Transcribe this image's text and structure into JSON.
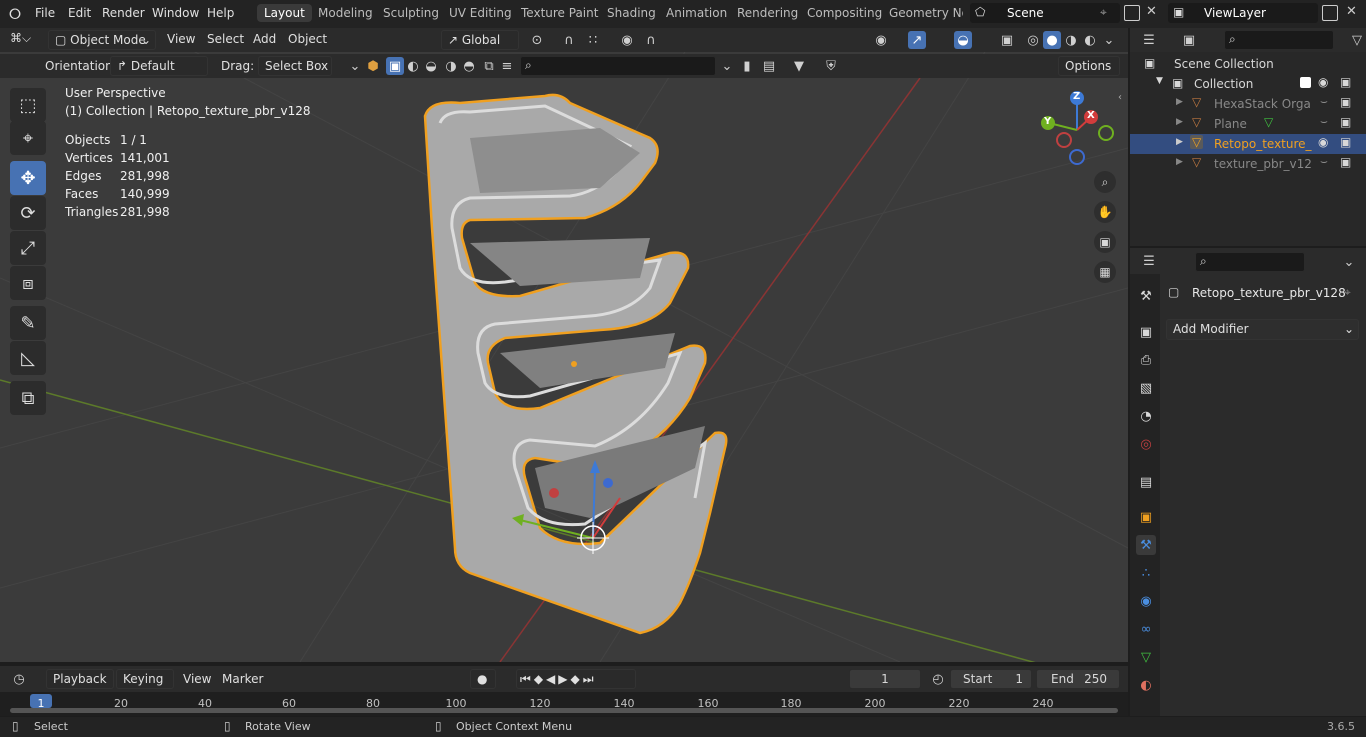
{
  "app": {
    "version": "3.6.5"
  },
  "menu": [
    "File",
    "Edit",
    "Render",
    "Window",
    "Help"
  ],
  "workspaces": [
    "Layout",
    "Modeling",
    "Sculpting",
    "UV Editing",
    "Texture Paint",
    "Shading",
    "Animation",
    "Rendering",
    "Compositing",
    "Geometry Noc"
  ],
  "active_workspace": "Layout",
  "scene_name": "Scene",
  "view_layer": "ViewLayer",
  "header": {
    "mode": "Object Mode",
    "menus": [
      "View",
      "Select",
      "Add",
      "Object"
    ],
    "transform_space": "Global",
    "orientation_label": "Orientation:",
    "orientation_value": "Default",
    "drag_label": "Drag:",
    "drag_value": "Select Box",
    "options_label": "Options"
  },
  "viewport": {
    "perspective": "User Perspective",
    "collection_path": "(1) Collection | Retopo_texture_pbr_v128",
    "stats": [
      {
        "label": "Objects",
        "value": "1 / 1"
      },
      {
        "label": "Vertices",
        "value": "141,001"
      },
      {
        "label": "Edges",
        "value": "281,998"
      },
      {
        "label": "Faces",
        "value": "140,999"
      },
      {
        "label": "Triangles",
        "value": "281,998"
      }
    ],
    "gizmo": {
      "x": "X",
      "y": "Y",
      "z": "Z"
    }
  },
  "outliner": {
    "root": "Scene Collection",
    "collection": "Collection",
    "items": [
      {
        "name": "HexaStack Orga",
        "selected": false
      },
      {
        "name": "Plane",
        "selected": false
      },
      {
        "name": "Retopo_texture_",
        "selected": true
      },
      {
        "name": "texture_pbr_v12",
        "selected": false
      }
    ]
  },
  "properties": {
    "object_name": "Retopo_texture_pbr_v128",
    "add_modifier": "Add Modifier"
  },
  "timeline": {
    "menus": [
      "Playback",
      "Keying",
      "View",
      "Marker"
    ],
    "current_frame": "1",
    "start_label": "Start",
    "start_value": "1",
    "end_label": "End",
    "end_value": "250",
    "ticks": [
      "1",
      "20",
      "40",
      "60",
      "80",
      "100",
      "120",
      "140",
      "160",
      "180",
      "200",
      "220",
      "240"
    ]
  },
  "statusbar": {
    "select": "Select",
    "rotate": "Rotate View",
    "context": "Object Context Menu"
  },
  "colors": {
    "accent": "#4772b3",
    "selected_outline": "#f0a020",
    "bg": "#1d1d1d",
    "viewport": "#3b3b3b"
  }
}
